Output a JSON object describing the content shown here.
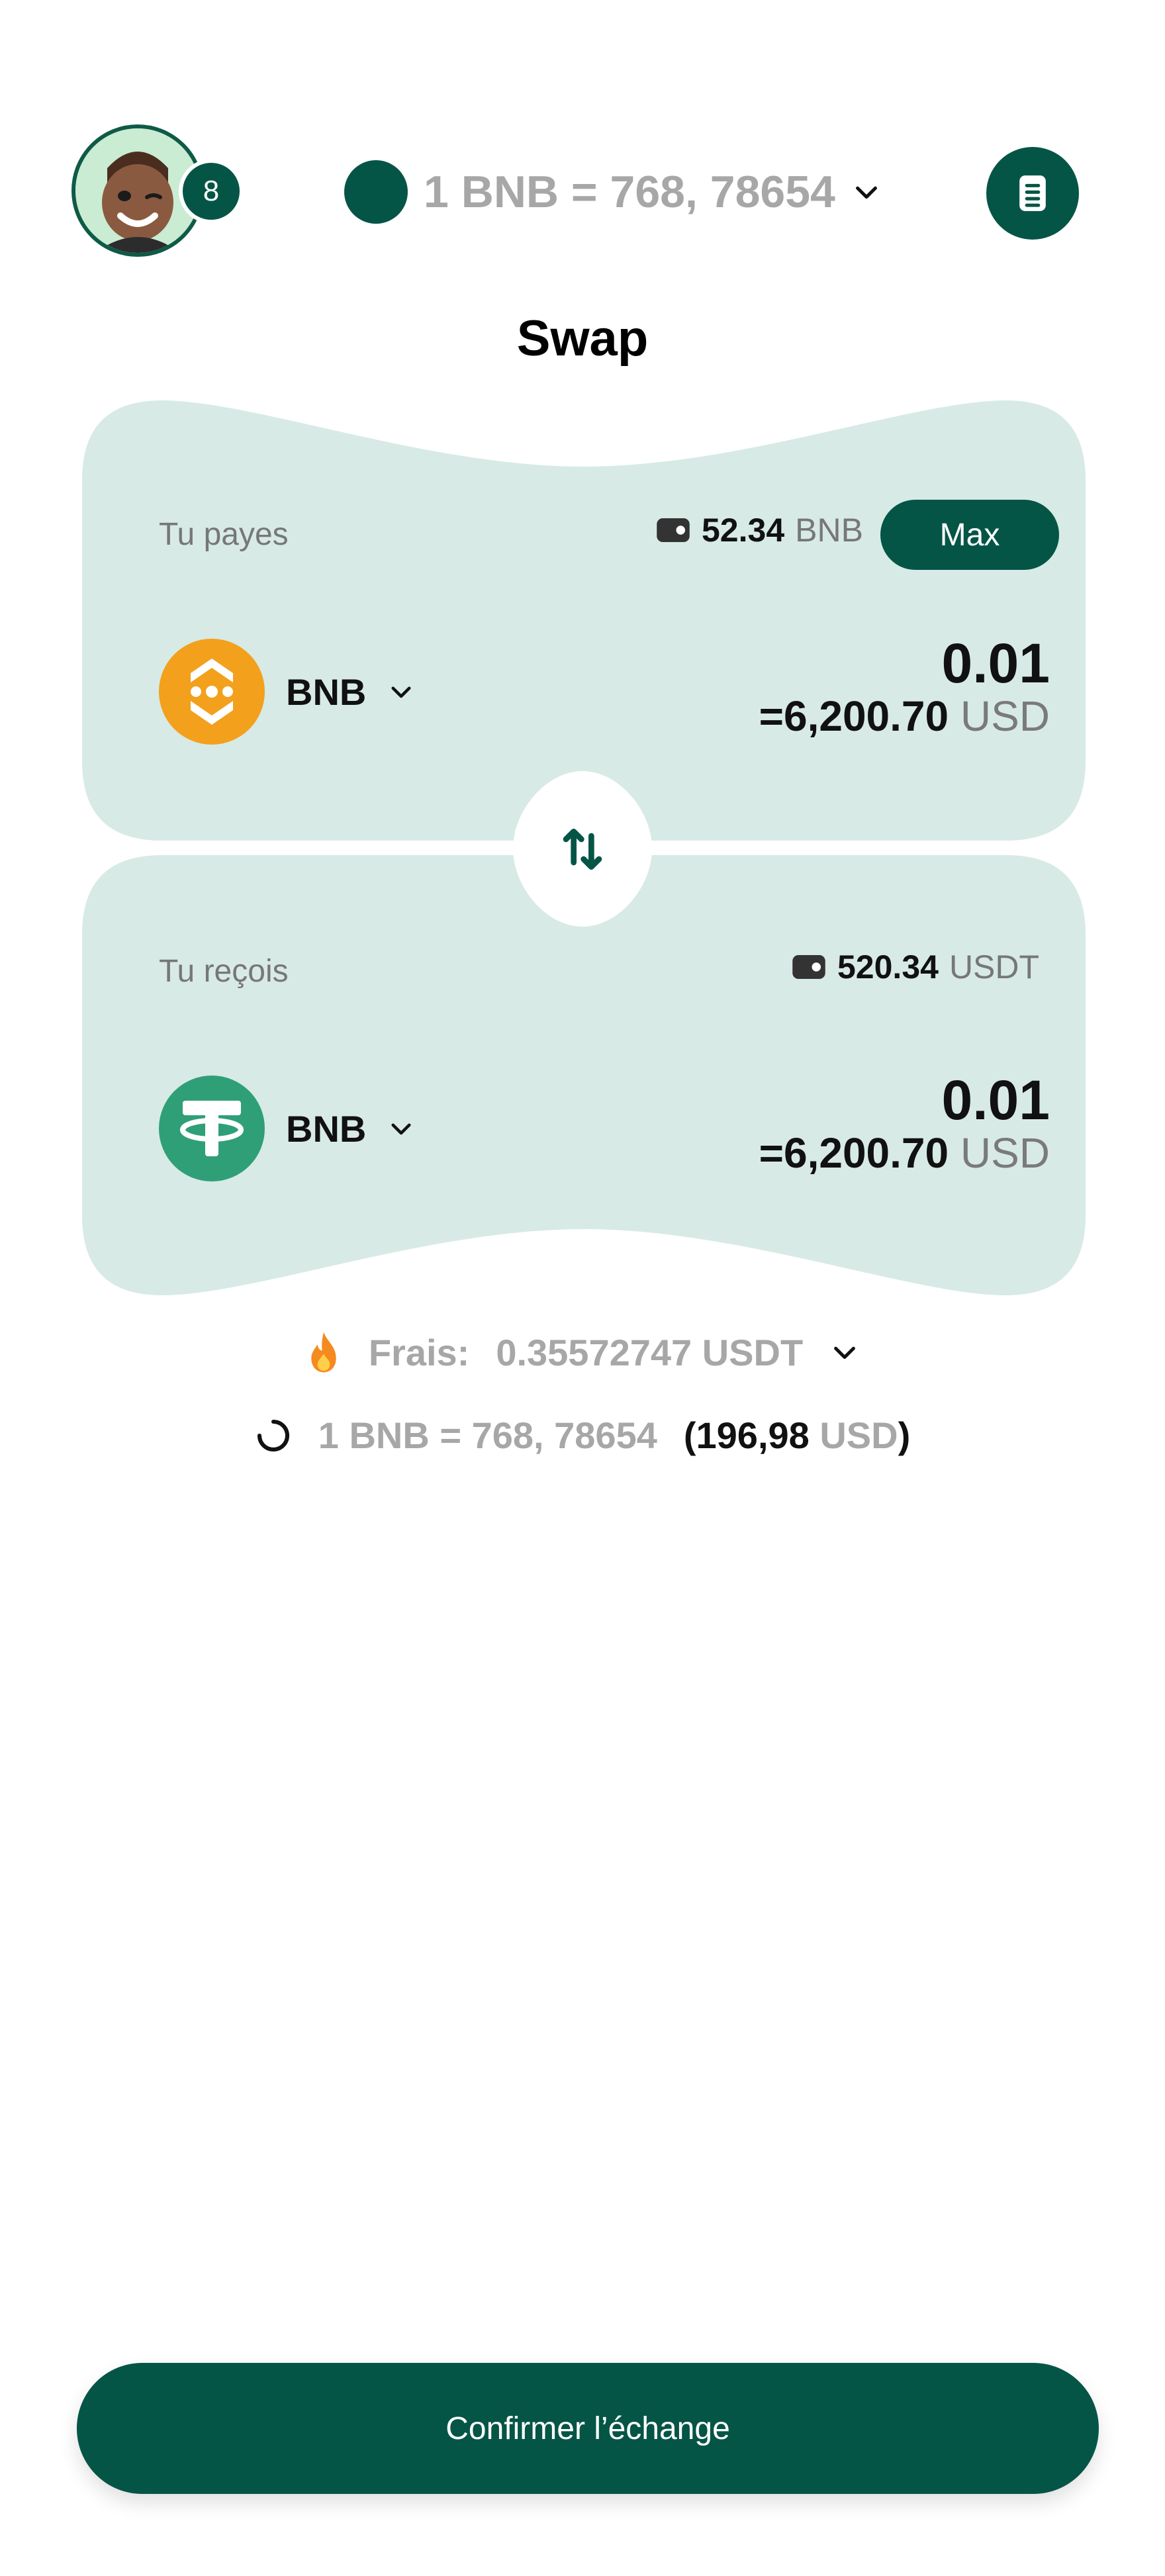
{
  "header": {
    "avatar_alt": "User avatar",
    "notifications_count": "8",
    "rate_text": "1 BNB = 768, 78654",
    "menu_icon": "document-icon"
  },
  "title": "Swap",
  "pay": {
    "label": "Tu payes",
    "balance_value": "52.34",
    "balance_unit": "BNB",
    "max_label": "Max",
    "token_name": "BNB",
    "amount": "0.01",
    "usd_value": "=6,200.70",
    "usd_unit": "USD",
    "icon": "bnb-coin-icon"
  },
  "receive": {
    "label": "Tu reçois",
    "balance_value": "520.34",
    "balance_unit": "USDT",
    "token_name": "BNB",
    "amount": "0.01",
    "usd_value": "=6,200.70",
    "usd_unit": "USD",
    "icon": "tether-coin-icon"
  },
  "fees": {
    "label": "Frais:",
    "value": "0.35572747 USDT"
  },
  "rate_footer": {
    "text": "1 BNB = 768, 78654",
    "open_paren": "(",
    "usd_number": "196,98",
    "usd_unit": "USD",
    "close_paren": ")"
  },
  "confirm_label": "Confirmer l’échange",
  "colors": {
    "primary": "#055546",
    "card_bg": "#d7eae6",
    "bnb_orange": "#f3a01c",
    "tether_green": "#2f9f78"
  }
}
